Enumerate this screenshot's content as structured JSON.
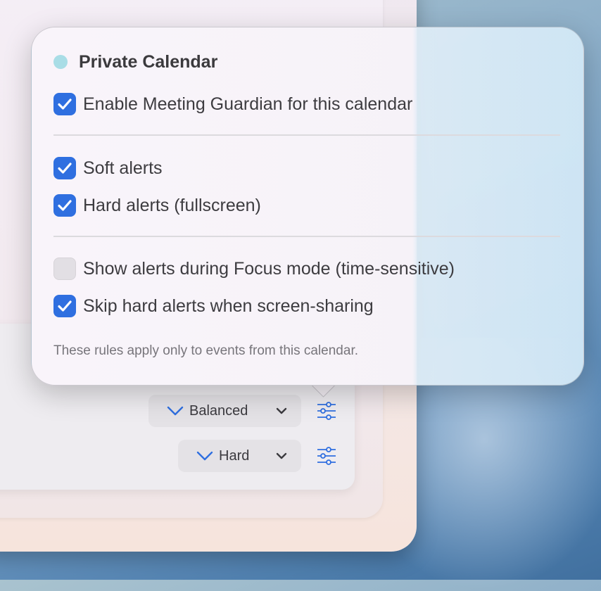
{
  "popover": {
    "title": "Private Calendar",
    "enable_label": "Enable Meeting Guardian for this calendar",
    "enable_checked": true,
    "options": [
      {
        "label": "Soft alerts",
        "checked": true
      },
      {
        "label": "Hard alerts (fullscreen)",
        "checked": true
      },
      {
        "label": "Show alerts during Focus mode (time-sensitive)",
        "checked": false
      },
      {
        "label": "Skip hard alerts when screen-sharing",
        "checked": true
      }
    ],
    "footnote": "These rules apply only to events from this calendar."
  },
  "rows": [
    {
      "mode": "Balanced"
    },
    {
      "mode": "Hard"
    }
  ],
  "colors": {
    "accent": "#2f6fe0",
    "calendar_dot": "#a9dde6"
  }
}
